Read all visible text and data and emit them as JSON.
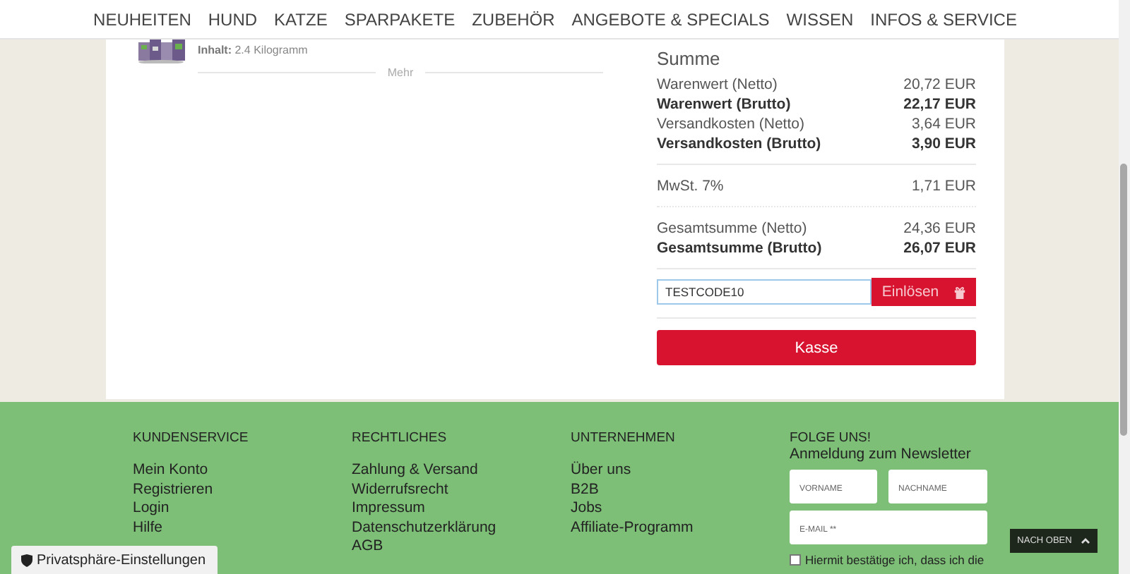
{
  "nav": [
    "NEUHEITEN",
    "HUND",
    "KATZE",
    "SPARPAKETE",
    "ZUBEHÖR",
    "ANGEBOTE & SPECIALS",
    "WISSEN",
    "INFOS & SERVICE"
  ],
  "product": {
    "content_label": "Inhalt:",
    "content_value": "2.4 Kilogramm",
    "more": "Mehr"
  },
  "summary": {
    "title": "Summe",
    "groups": [
      {
        "rows": [
          {
            "label": "Warenwert (Netto)",
            "value": "20,72 EUR",
            "bold": false
          },
          {
            "label": "Warenwert (Brutto)",
            "value": "22,17 EUR",
            "bold": true
          },
          {
            "label": "Versandkosten (Netto)",
            "value": "3,64 EUR",
            "bold": false
          },
          {
            "label": "Versandkosten (Brutto)",
            "value": "3,90 EUR",
            "bold": true
          }
        ]
      },
      {
        "rows": [
          {
            "label": "MwSt. 7%",
            "value": "1,71 EUR",
            "bold": false
          }
        ]
      },
      {
        "rows": [
          {
            "label": "Gesamtsumme (Netto)",
            "value": "24,36 EUR",
            "bold": false
          },
          {
            "label": "Gesamtsumme (Brutto)",
            "value": "26,07 EUR",
            "bold": true
          }
        ]
      }
    ]
  },
  "coupon": {
    "value": "TESTCODE10",
    "focused": true,
    "button": "Einlösen"
  },
  "checkout": "Kasse",
  "footer": {
    "columns": [
      {
        "heading": "KUNDENSERVICE",
        "links": [
          "Mein Konto",
          "Registrieren",
          "Login",
          "Hilfe"
        ]
      },
      {
        "heading": "RECHTLICHES",
        "links": [
          "Zahlung & Versand",
          "Widerrufsrecht",
          "Impressum",
          "Datenschutzerklärung",
          "AGB"
        ]
      },
      {
        "heading": "UNTERNEHMEN",
        "links": [
          "Über uns",
          "B2B",
          "Jobs",
          "Affiliate-Programm"
        ]
      }
    ],
    "newsletter": {
      "heading": "FOLGE UNS!",
      "subheading": "Anmeldung zum Newsletter",
      "fields": [
        "VORNAME",
        "NACHNAME",
        "E-MAIL **"
      ],
      "consent": "Hiermit bestätige ich, dass ich die",
      "consent_checked": false
    }
  },
  "privacy_button": "Privatsphäre-Einstellungen",
  "back_to_top": "NACH OBEN"
}
